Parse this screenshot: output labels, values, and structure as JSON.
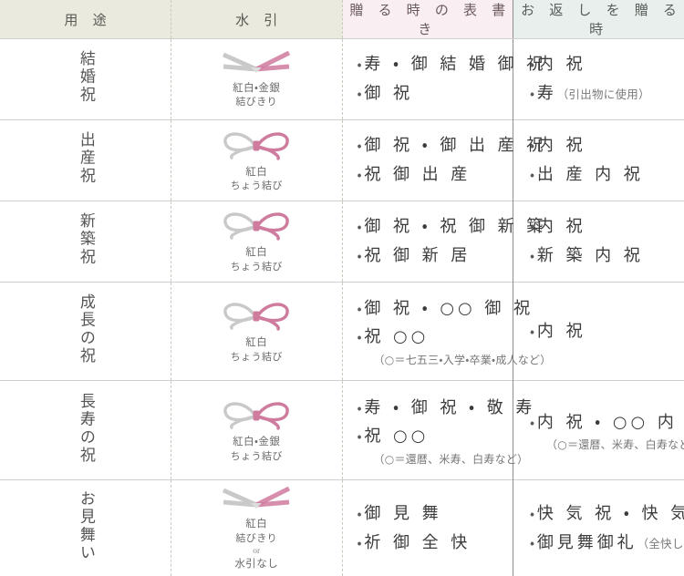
{
  "table": {
    "headers": [
      {
        "label": "用 途",
        "name": "header-use"
      },
      {
        "label": "水 引",
        "name": "header-mizuhiki"
      },
      {
        "label": "贈 る 時 の 表 書 き",
        "name": "header-giving"
      },
      {
        "label": "お 返 し を 贈 る 時",
        "name": "header-return"
      }
    ],
    "colors": {
      "header_use_bg": "#eaeade",
      "header_mizuhiki_bg": "#eaeade",
      "header_giving_bg": "#f9eef1",
      "header_return_bg": "#e9efec",
      "mizuhiki_pink": "#cf7b9e",
      "mizuhiki_silver": "#c9c9c9",
      "rule_line": "#cfcfcf",
      "divider_dashed": "#c9c9be",
      "divider_solid": "#8e8e8e",
      "text_primary": "#3c3c3c",
      "text_note": "#777777"
    },
    "rows": [
      {
        "use": "結婚祝",
        "mizuhiki": {
          "knot": "musubikiri",
          "line1": "紅白・金銀",
          "line2": "結びきり",
          "or": "",
          "line3": ""
        },
        "giving": [
          {
            "bullet": "・",
            "text": "寿 ・ 御 結 婚 御 祝",
            "note": ""
          },
          {
            "bullet": "・",
            "text": "御 祝",
            "note": ""
          }
        ],
        "giving_note": "",
        "returning": [
          {
            "bullet": "・",
            "text": "内 祝",
            "note": ""
          },
          {
            "bullet": "・",
            "text": "寿",
            "note": "（引出物に使用）"
          }
        ],
        "returning_note": ""
      },
      {
        "use": "出産祝",
        "mizuhiki": {
          "knot": "chomusubi",
          "line1": "紅白",
          "line2": "ちょう結び",
          "or": "",
          "line3": ""
        },
        "giving": [
          {
            "bullet": "・",
            "text": "御 祝 ・ 御 出 産 祝",
            "note": ""
          },
          {
            "bullet": "・",
            "text": "祝 御 出 産",
            "note": ""
          }
        ],
        "giving_note": "",
        "returning": [
          {
            "bullet": "・",
            "text": "内 祝",
            "note": ""
          },
          {
            "bullet": "・",
            "text": "出 産 内 祝",
            "note": ""
          }
        ],
        "returning_note": ""
      },
      {
        "use": "新築祝",
        "mizuhiki": {
          "knot": "chomusubi",
          "line1": "紅白",
          "line2": "ちょう結び",
          "or": "",
          "line3": ""
        },
        "giving": [
          {
            "bullet": "・",
            "text": "御 祝 ・ 祝 御 新 築",
            "note": ""
          },
          {
            "bullet": "・",
            "text": "祝 御 新 居",
            "note": ""
          }
        ],
        "giving_note": "",
        "returning": [
          {
            "bullet": "・",
            "text": "内 祝",
            "note": ""
          },
          {
            "bullet": "・",
            "text": "新 築 内 祝",
            "note": ""
          }
        ],
        "returning_note": ""
      },
      {
        "use": "成長の祝",
        "mizuhiki": {
          "knot": "chomusubi",
          "line1": "紅白",
          "line2": "ちょう結び",
          "or": "",
          "line3": ""
        },
        "giving": [
          {
            "bullet": "・",
            "text": "御 祝 ・ ○○ 御 祝",
            "note": ""
          },
          {
            "bullet": "・",
            "text": "祝 ○○",
            "note": ""
          }
        ],
        "giving_note": "（○＝七五三・入学・卒業・成人など）",
        "returning": [
          {
            "bullet": "・",
            "text": "内 祝",
            "note": ""
          }
        ],
        "returning_note": ""
      },
      {
        "use": "長寿の祝",
        "mizuhiki": {
          "knot": "chomusubi",
          "line1": "紅白・金銀",
          "line2": "ちょう結び",
          "or": "",
          "line3": ""
        },
        "giving": [
          {
            "bullet": "・",
            "text": "寿 ・ 御 祝 ・ 敬 寿",
            "note": ""
          },
          {
            "bullet": "・",
            "text": "祝 ○○",
            "note": ""
          }
        ],
        "giving_note": "（○＝還暦、米寿、白寿など）",
        "returning": [
          {
            "bullet": "・",
            "text": "内 祝 ・ ○○ 内 祝",
            "note": ""
          }
        ],
        "returning_note": "（○＝還暦、米寿、白寿など）"
      },
      {
        "use": "お見舞い",
        "mizuhiki": {
          "knot": "musubikiri",
          "line1": "紅白",
          "line2": "結びきり",
          "or": "or",
          "line3": "水引なし"
        },
        "giving": [
          {
            "bullet": "・",
            "text": "御 見 舞",
            "note": ""
          },
          {
            "bullet": "・",
            "text": "祈 御 全 快",
            "note": ""
          }
        ],
        "giving_note": "",
        "returning": [
          {
            "bullet": "・",
            "text": "快 気 祝 ・ 快 気 内 祝",
            "note": ""
          },
          {
            "bullet": "・",
            "text": "御見舞御礼",
            "note": "（全快していない時）"
          }
        ],
        "returning_note": ""
      }
    ]
  }
}
